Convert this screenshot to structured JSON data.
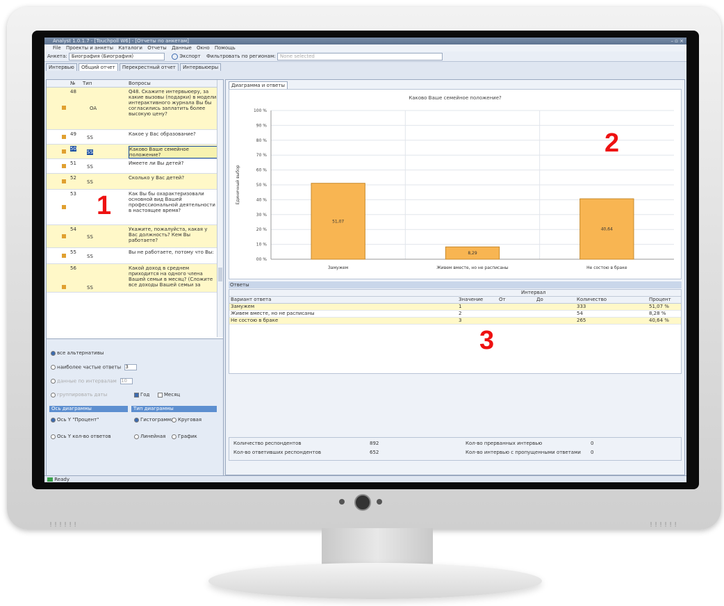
{
  "window": {
    "title": "Analyst 1.0.1.7 - [Touchpoll W6] - [Отчеты по анкетам]",
    "controls": "– ▫ ×"
  },
  "menu": [
    "File",
    "Проекты и анкеты",
    "Каталоги",
    "Отчеты",
    "Данные",
    "Окно",
    "Помощь"
  ],
  "toolbar": {
    "anketa_label": "Анкета:",
    "anketa_value": "Биография (Биография)",
    "export_label": "Экспорт",
    "filter_label": "Фильтровать по регионам:",
    "filter_value": "None selected"
  },
  "tabs": [
    "Интервью",
    "Общий отчет",
    "Перекрестный отчет",
    "Интервьюеры"
  ],
  "active_tab": 1,
  "questions": {
    "headers": {
      "num": "№",
      "type": "Тип",
      "question": "Вопросы"
    },
    "rows": [
      {
        "num": "48",
        "type": "OA",
        "text": "Q48. Скажите интервьюеру, за какие вызовы (подарки) в модели интерактивного журнала Вы бы согласились заплатить более высокую цену?"
      },
      {
        "num": "49",
        "type": "SS",
        "text": "Какое у Вас образование?"
      },
      {
        "num": "50",
        "type": "SS",
        "text": "Каково Ваше семейное положение?"
      },
      {
        "num": "51",
        "type": "SS",
        "text": "Имеете ли Вы детей?"
      },
      {
        "num": "52",
        "type": "SS",
        "text": "Сколько у Вас детей?"
      },
      {
        "num": "53",
        "type": "SS",
        "text": "Как Вы бы охарактеризовали основной вид Вашей профессиональной деятельности в настоящее время?"
      },
      {
        "num": "54",
        "type": "SS",
        "text": "Укажите, пожалуйста, какая у Вас должность? Кем Вы работаете?"
      },
      {
        "num": "55",
        "type": "SS",
        "text": "Вы не работаете, потому что Вы:"
      },
      {
        "num": "56",
        "type": "SS",
        "text": "Какой доход в среднем приходится на одного члена Вашей семьи в месяц? (Сложите все доходы Вашей семьи за"
      }
    ]
  },
  "options": {
    "all_alternatives": "все альтернативы",
    "most_frequent": "наиболее частые ответы",
    "most_frequent_value": "3",
    "by_intervals": "данные по интервалам",
    "by_intervals_value": "10",
    "group_dates": "группировать даты",
    "year": "Год",
    "month": "Месяц",
    "axis_header": "Ось диаграммы",
    "type_header": "Тип диаграммы",
    "axis_percent": "Ось Y \"Процент\"",
    "axis_count": "Ось Y кол-во ответов",
    "histogram": "Гистограмма",
    "pie": "Круговая",
    "linear": "Линейная",
    "graph": "График"
  },
  "right_tab": "Диаграмма и ответы",
  "chart_data": {
    "type": "bar",
    "title": "Каково Ваше семейное положение?",
    "ylabel": "Единичный выбор",
    "categories": [
      "Замужем",
      "Живем вместе, но не расписаны",
      "Не состою в браке"
    ],
    "values": [
      51.07,
      8.29,
      40.64
    ],
    "value_labels": [
      "51,07",
      "8,29",
      "40,64"
    ],
    "ylim": [
      0,
      100
    ],
    "yticks": [
      "00 %",
      "10 %",
      "20 %",
      "30 %",
      "40 %",
      "50 %",
      "60 %",
      "70 %",
      "80 %",
      "90 %",
      "100 %"
    ],
    "grid": true,
    "bar_color": "#f8b552"
  },
  "answers": {
    "header": "Ответы",
    "interval_label": "Интервал",
    "columns": [
      "Вариант ответа",
      "Значение",
      "От",
      "До",
      "Количество",
      "Процент"
    ],
    "rows": [
      [
        "Замужем",
        "1",
        "",
        "",
        "333",
        "51,07 %"
      ],
      [
        "Живем вместе, но не расписаны",
        "2",
        "",
        "",
        "54",
        "8,28 %"
      ],
      [
        "Не состою в браке",
        "3",
        "",
        "",
        "265",
        "40,64 %"
      ]
    ]
  },
  "stats": {
    "respondents_label": "Количество респондентов",
    "respondents_value": "892",
    "answered_label": "Кол-во ответивших респондентов",
    "answered_value": "652",
    "interrupted_label": "Кол-во прерванных интервью",
    "interrupted_value": "0",
    "skipped_label": "Кол-во интервью с пропущенными ответами",
    "skipped_value": "0"
  },
  "statusbar": "Ready",
  "callouts": [
    "1",
    "2",
    "3"
  ],
  "monitor": {
    "vent_left": "!!!!!!",
    "vent_right": "!!!!!!"
  }
}
